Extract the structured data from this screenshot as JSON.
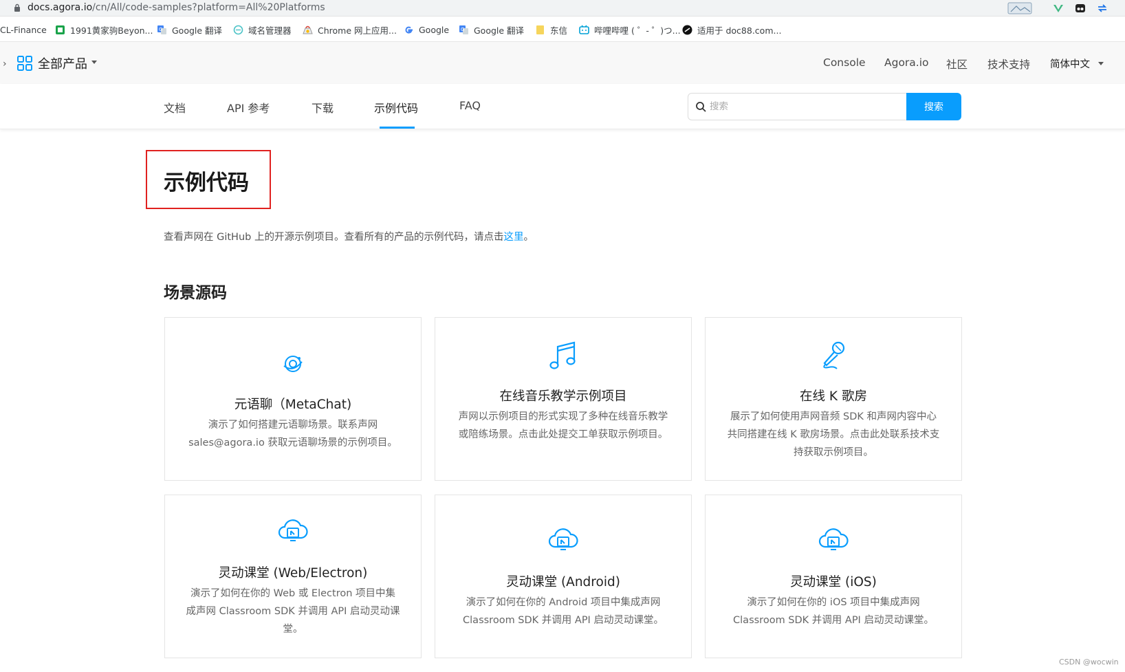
{
  "browser": {
    "url_host": "docs.agora.io",
    "url_path": "/cn/All/code-samples?platform=All%20Platforms"
  },
  "bookmarks": [
    {
      "label": "CL-Finance",
      "icon": "none"
    },
    {
      "label": "1991黄家驹Beyon...",
      "icon": "green-square-icon"
    },
    {
      "label": "Google 翻译",
      "icon": "google-translate-icon"
    },
    {
      "label": "域名管理器",
      "icon": "domain-manager-icon"
    },
    {
      "label": "Chrome 网上应用...",
      "icon": "chrome-webstore-icon"
    },
    {
      "label": "Google",
      "icon": "google-icon"
    },
    {
      "label": "Google 翻译",
      "icon": "google-translate-icon"
    },
    {
      "label": "东信",
      "icon": "folder-icon"
    },
    {
      "label": "哔哩哔哩 ( ゜- ゜)つ...",
      "icon": "bilibili-icon"
    },
    {
      "label": "适用于 doc88.com...",
      "icon": "doc88-icon"
    }
  ],
  "topnav": {
    "all_products": "全部产品",
    "links": [
      "Console",
      "Agora.io",
      "社区",
      "技术支持"
    ],
    "language": "简体中文"
  },
  "subnav": {
    "tabs": [
      "文档",
      "API 参考",
      "下载",
      "示例代码",
      "FAQ"
    ],
    "active_tab": "示例代码",
    "search_placeholder": "搜索",
    "search_button": "搜索"
  },
  "page": {
    "title": "示例代码",
    "intro_text": "查看声网在 GitHub 上的开源示例项目。查看所有的产品的示例代码，请点击",
    "intro_link": "这里",
    "intro_end": "。",
    "section_title": "场景源码"
  },
  "cards": [
    {
      "title": "元语聊（MetaChat)",
      "desc": "演示了如何搭建元语聊场景。联系声网 sales@agora.io 获取元语聊场景的示例项目。",
      "icon": "metachat-icon"
    },
    {
      "title": "在线音乐教学示例项目",
      "desc": "声网以示例项目的形式实现了多种在线音乐教学或陪练场景。点击此处提交工单获取示例项目。",
      "icon": "music-note-icon"
    },
    {
      "title": "在线 K 歌房",
      "desc": "展示了如何使用声网音频 SDK 和声网内容中心共同搭建在线 K 歌房场景。点击此处联系技术支持获取示例项目。",
      "icon": "microphone-icon"
    },
    {
      "title": "灵动课堂 (Web/Electron)",
      "desc": "演示了如何在你的 Web 或 Electron 项目中集成声网 Classroom SDK 并调用 API 启动灵动课堂。",
      "icon": "cloud-classroom-icon"
    },
    {
      "title": "灵动课堂 (Android)",
      "desc": "演示了如何在你的 Android 项目中集成声网 Classroom SDK 并调用 API 启动灵动课堂。",
      "icon": "cloud-classroom-icon"
    },
    {
      "title": "灵动课堂 (iOS)",
      "desc": "演示了如何在你的 iOS 项目中集成声网 Classroom SDK 并调用 API 启动灵动课堂。",
      "icon": "cloud-classroom-icon"
    }
  ],
  "watermark": "CSDN @wocwin",
  "colors": {
    "accent": "#099dfd",
    "highlight_box": "#e0211f"
  }
}
